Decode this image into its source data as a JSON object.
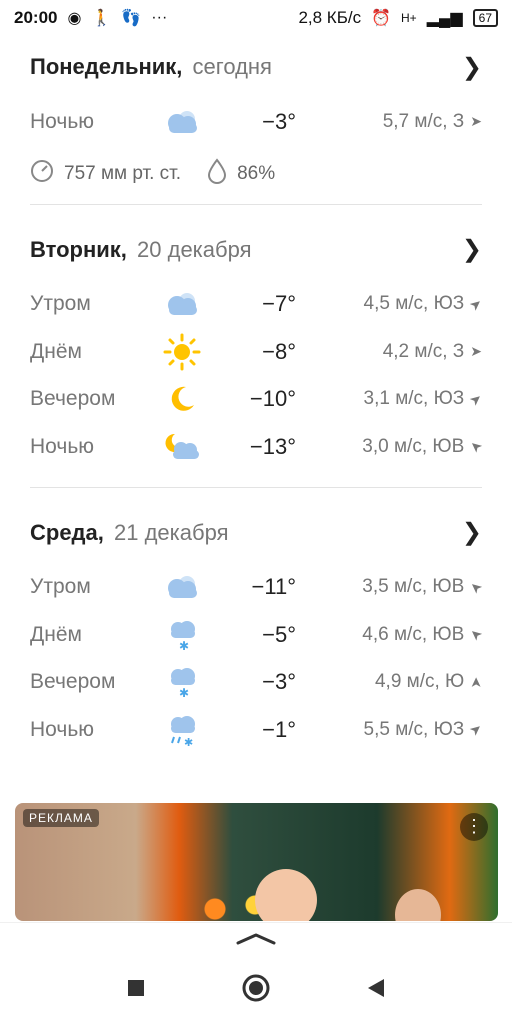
{
  "status_bar": {
    "time": "20:00",
    "speed": "2,8 КБ/с",
    "battery": "67",
    "network": "H+"
  },
  "days": [
    {
      "name": "Понедельник,",
      "date": "сегодня",
      "rows": [
        {
          "period": "Ночью",
          "icon": "cloudy-icon",
          "temp": "−3°",
          "wind": "5,7 м/с, З",
          "arrow": "➤"
        }
      ],
      "pressure": "757 мм рт. ст.",
      "humidity": "86%"
    },
    {
      "name": "Вторник,",
      "date": "20 декабря",
      "rows": [
        {
          "period": "Утром",
          "icon": "cloudy-icon",
          "temp": "−7°",
          "wind": "4,5 м/с, ЮЗ",
          "arrow": "➤"
        },
        {
          "period": "Днём",
          "icon": "sun-icon",
          "temp": "−8°",
          "wind": "4,2 м/с, З",
          "arrow": "➤"
        },
        {
          "period": "Вечером",
          "icon": "moon-icon",
          "temp": "−10°",
          "wind": "3,1 м/с, ЮЗ",
          "arrow": "➤"
        },
        {
          "period": "Ночью",
          "icon": "moon-cloud-icon",
          "temp": "−13°",
          "wind": "3,0 м/с, ЮВ",
          "arrow": "➤"
        }
      ]
    },
    {
      "name": "Среда,",
      "date": "21 декабря",
      "rows": [
        {
          "period": "Утром",
          "icon": "cloudy-icon",
          "temp": "−11°",
          "wind": "3,5 м/с, ЮВ",
          "arrow": "➤"
        },
        {
          "period": "Днём",
          "icon": "snow-light-icon",
          "temp": "−5°",
          "wind": "4,6 м/с, ЮВ",
          "arrow": "➤"
        },
        {
          "period": "Вечером",
          "icon": "snow-light-icon",
          "temp": "−3°",
          "wind": "4,9 м/с, Ю",
          "arrow": "➤"
        },
        {
          "period": "Ночью",
          "icon": "snow-rain-icon",
          "temp": "−1°",
          "wind": "5,5 м/с, ЮЗ",
          "arrow": "➤"
        }
      ]
    }
  ],
  "ad": {
    "label": "РЕКЛАМА",
    "menu": "⋮"
  },
  "colors": {
    "cloud": "#9fc4ec",
    "sun": "#ffc400",
    "moon": "#ffbe00",
    "snow": "#4aa6e8"
  }
}
